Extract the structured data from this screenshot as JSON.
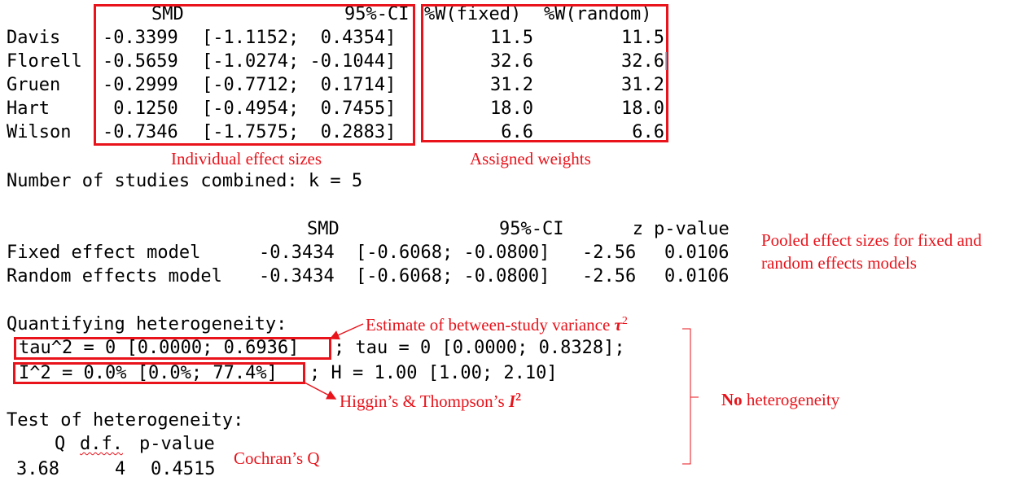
{
  "studies_table": {
    "headers": {
      "smd": "SMD",
      "ci": "95%-CI",
      "w_fixed": "%W(fixed)",
      "w_random": "%W(random)"
    },
    "rows": [
      {
        "name": "Davis",
        "smd": "-0.3399",
        "ci": "[-1.1152;  0.4354]",
        "w_fixed": "11.5",
        "w_random": "11.5"
      },
      {
        "name": "Florell",
        "smd": "-0.5659",
        "ci": "[-1.0274; -0.1044]",
        "w_fixed": "32.6",
        "w_random": "32.6"
      },
      {
        "name": "Gruen",
        "smd": "-0.2999",
        "ci": "[-0.7712;  0.1714]",
        "w_fixed": "31.2",
        "w_random": "31.2"
      },
      {
        "name": "Hart",
        "smd": " 0.1250",
        "ci": "[-0.4954;  0.7455]",
        "w_fixed": "18.0",
        "w_random": "18.0"
      },
      {
        "name": "Wilson",
        "smd": "-0.7346",
        "ci": "[-1.7575;  0.2883]",
        "w_fixed": "6.6",
        "w_random": "6.6"
      }
    ]
  },
  "annotations": {
    "effect_sizes": "Individual effect sizes",
    "weights": "Assigned weights",
    "pooled_line1": "Pooled effect sizes for fixed and",
    "pooled_line2": "random effects models",
    "tau_prefix": "Estimate of between-study variance ",
    "tau_symbol": "τ",
    "tau_sup": "2",
    "higgins_prefix": "Higgin’s & Thompson’s ",
    "higgins_symbol": "I",
    "higgins_sup": "2",
    "no_word": "No",
    "heterogeneity_word": " heterogeneity",
    "cochran": "Cochran’s Q"
  },
  "studies_combined": "Number of studies combined: k = 5",
  "pooled_table": {
    "headers": {
      "smd": "SMD",
      "ci": "95%-CI",
      "z": "z",
      "p": "p-value"
    },
    "rows": [
      {
        "label": "Fixed effect model",
        "smd": "-0.3434",
        "ci": "[-0.6068; -0.0800]",
        "z": "-2.56",
        "p": "0.0106"
      },
      {
        "label": "Random effects model",
        "smd": "-0.3434",
        "ci": "[-0.6068; -0.0800]",
        "z": "-2.56",
        "p": "0.0106"
      }
    ]
  },
  "heterogeneity": {
    "title": "Quantifying heterogeneity:",
    "tau2": "tau^2 = 0 [0.0000; 0.6936]",
    "tau_rest": "; tau = 0 [0.0000; 0.8328];",
    "i2": "I^2 = 0.0% [0.0%; 77.4%]",
    "h_rest": "; H = 1.00 [1.00; 2.10]"
  },
  "test": {
    "title": "Test of heterogeneity:",
    "headers": {
      "q": "Q",
      "df": "d.f.",
      "p": "p-value"
    },
    "values": {
      "q": "3.68",
      "df": "4",
      "p": "0.4515"
    }
  },
  "colors": {
    "annotation_red": "#e8131b",
    "text": "#000000"
  }
}
